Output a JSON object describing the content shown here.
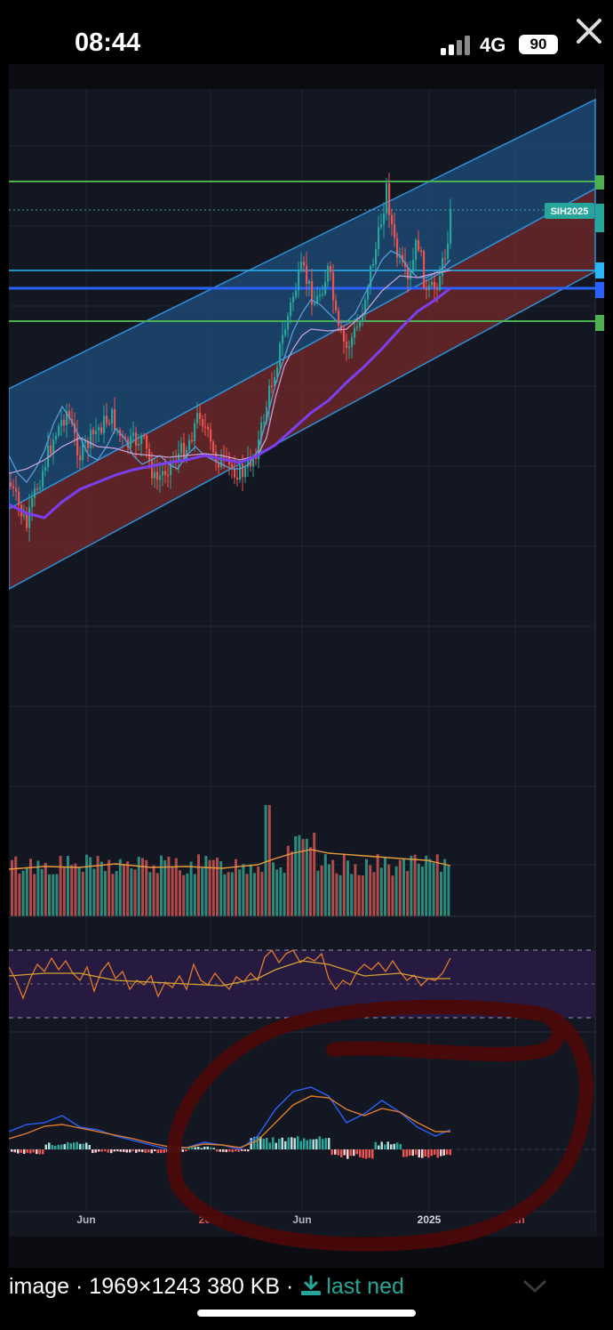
{
  "status_bar": {
    "time": "08:44",
    "network": "4G",
    "battery": "90"
  },
  "chart": {
    "symbol_tag": "SIH2025",
    "x_axis_labels": [
      "Jun",
      "2024",
      "Jun",
      "2025",
      "Jun"
    ],
    "colors": {
      "background": "#131722",
      "up_candle": "#26a69a",
      "down_candle": "#ef5350",
      "channel_upper": "#1e5a8a",
      "channel_lower": "#8b2e2e",
      "ma_long": "#7b3ff2",
      "horizontal_green": "#4caf50",
      "horizontal_cyan": "#29b6f6",
      "horizontal_blue": "#2962ff",
      "annotation_circle": "#5a0a0a"
    }
  },
  "caption": {
    "prefix": "image · 1969×1243 380 KB ·",
    "download_label": "last ned"
  }
}
